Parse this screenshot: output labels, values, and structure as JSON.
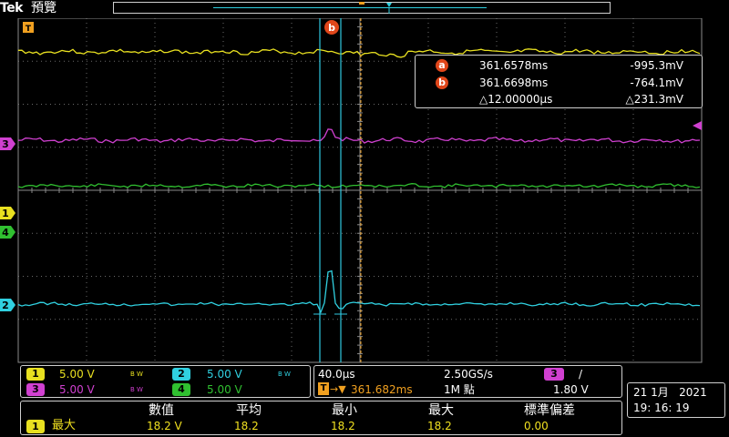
{
  "header": {
    "brand": "Tek",
    "run_state": "預覽"
  },
  "colors": {
    "ch1": "#e8e020",
    "ch2": "#30d0e0",
    "ch3": "#d040d0",
    "ch4": "#30c030",
    "cursor_badge": "#e0461a",
    "trigger": "#f0a020",
    "graticule": "#6a6a6a",
    "cursor_line": "#30c8e0"
  },
  "markers": {
    "trigger_position": "T",
    "ch1": "1",
    "ch2": "2",
    "ch3": "3",
    "ch4": "4",
    "cursor_b": "b"
  },
  "cursors": {
    "a": {
      "label": "a",
      "time": "361.6578ms",
      "value": "-995.3mV"
    },
    "b": {
      "label": "b",
      "time": "361.6698ms",
      "value": "-764.1mV"
    },
    "delta": {
      "time": "△12.00000µs",
      "value": "△231.3mV"
    }
  },
  "channels": [
    {
      "id": "1",
      "scale": "5.00 V",
      "bw": "B W",
      "color": "#e8e020"
    },
    {
      "id": "2",
      "scale": "5.00 V",
      "bw": "B W",
      "color": "#30d0e0"
    },
    {
      "id": "3",
      "scale": "5.00 V",
      "bw": "B W",
      "color": "#d040d0"
    },
    {
      "id": "4",
      "scale": "5.00 V",
      "bw": "",
      "color": "#30c030"
    }
  ],
  "timebase": {
    "scale": "40.0µs",
    "sample_rate": "2.50GS/s",
    "position": "361.682ms",
    "record_length": "1M 點",
    "trigger_source": "3",
    "trigger_slope": "/",
    "trigger_level": "1.80 V"
  },
  "datetime": {
    "date": "21 1月   2021",
    "time": "19: 16: 19"
  },
  "measurements": {
    "headers": [
      "數值",
      "平均",
      "最小",
      "最大",
      "標準偏差"
    ],
    "row": {
      "channel": "1",
      "name": "最大",
      "values": [
        "18.2 V",
        "18.2",
        "18.2",
        "18.2",
        "0.00"
      ]
    }
  }
}
